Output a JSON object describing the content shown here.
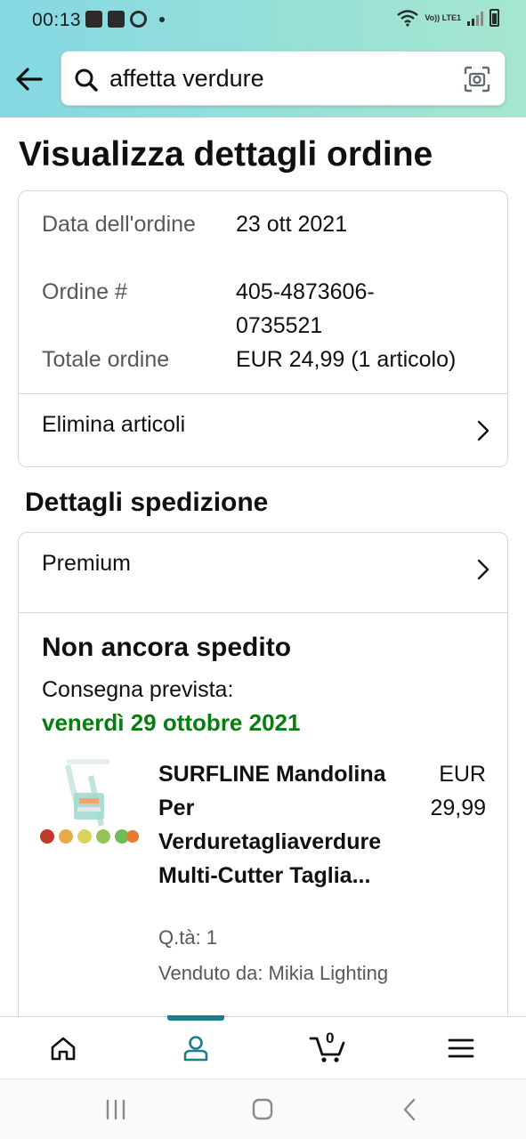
{
  "status_bar": {
    "time": "00:13",
    "network_label": "Vo)) LTE1"
  },
  "header": {
    "search": {
      "value": "affetta verdure",
      "placeholder": ""
    },
    "gradient_colors": [
      "#84d8e3",
      "#a6e6cf"
    ]
  },
  "page_title": "Visualizza dettagli ordine",
  "order_summary": {
    "rows": [
      {
        "label": "Data dell'ordine",
        "value": "23 ott 2021"
      },
      {
        "label": "Ordine #",
        "value": "405-4873606-0735521"
      },
      {
        "label": "Totale ordine",
        "value": "EUR 24,99 (1 articolo)"
      }
    ],
    "action_label": "Elimina articoli"
  },
  "shipping": {
    "section_title": "Dettagli spedizione",
    "service_label": "Premium",
    "status": "Non ancora spedito",
    "delivery_label": "Consegna prevista:",
    "delivery_date": "venerdì 29 ottobre 2021",
    "delivery_date_color": "#067d10",
    "item": {
      "title": "SURFLINE Mandolina Per Verduretagliaverdure Multi-Cutter Taglia...",
      "price": "EUR 29,99",
      "quantity": "Q.tà: 1",
      "seller": "Venduto da: Mikia Lighting"
    }
  },
  "bottom_nav": {
    "items": [
      "home-icon",
      "account-icon",
      "cart-icon",
      "menu-icon"
    ],
    "active": "account-icon",
    "cart_count": "0",
    "accent_color": "#1b7f8e"
  },
  "system_nav": {
    "items": [
      "recent-apps-icon",
      "home-circle-icon",
      "back-icon"
    ]
  }
}
